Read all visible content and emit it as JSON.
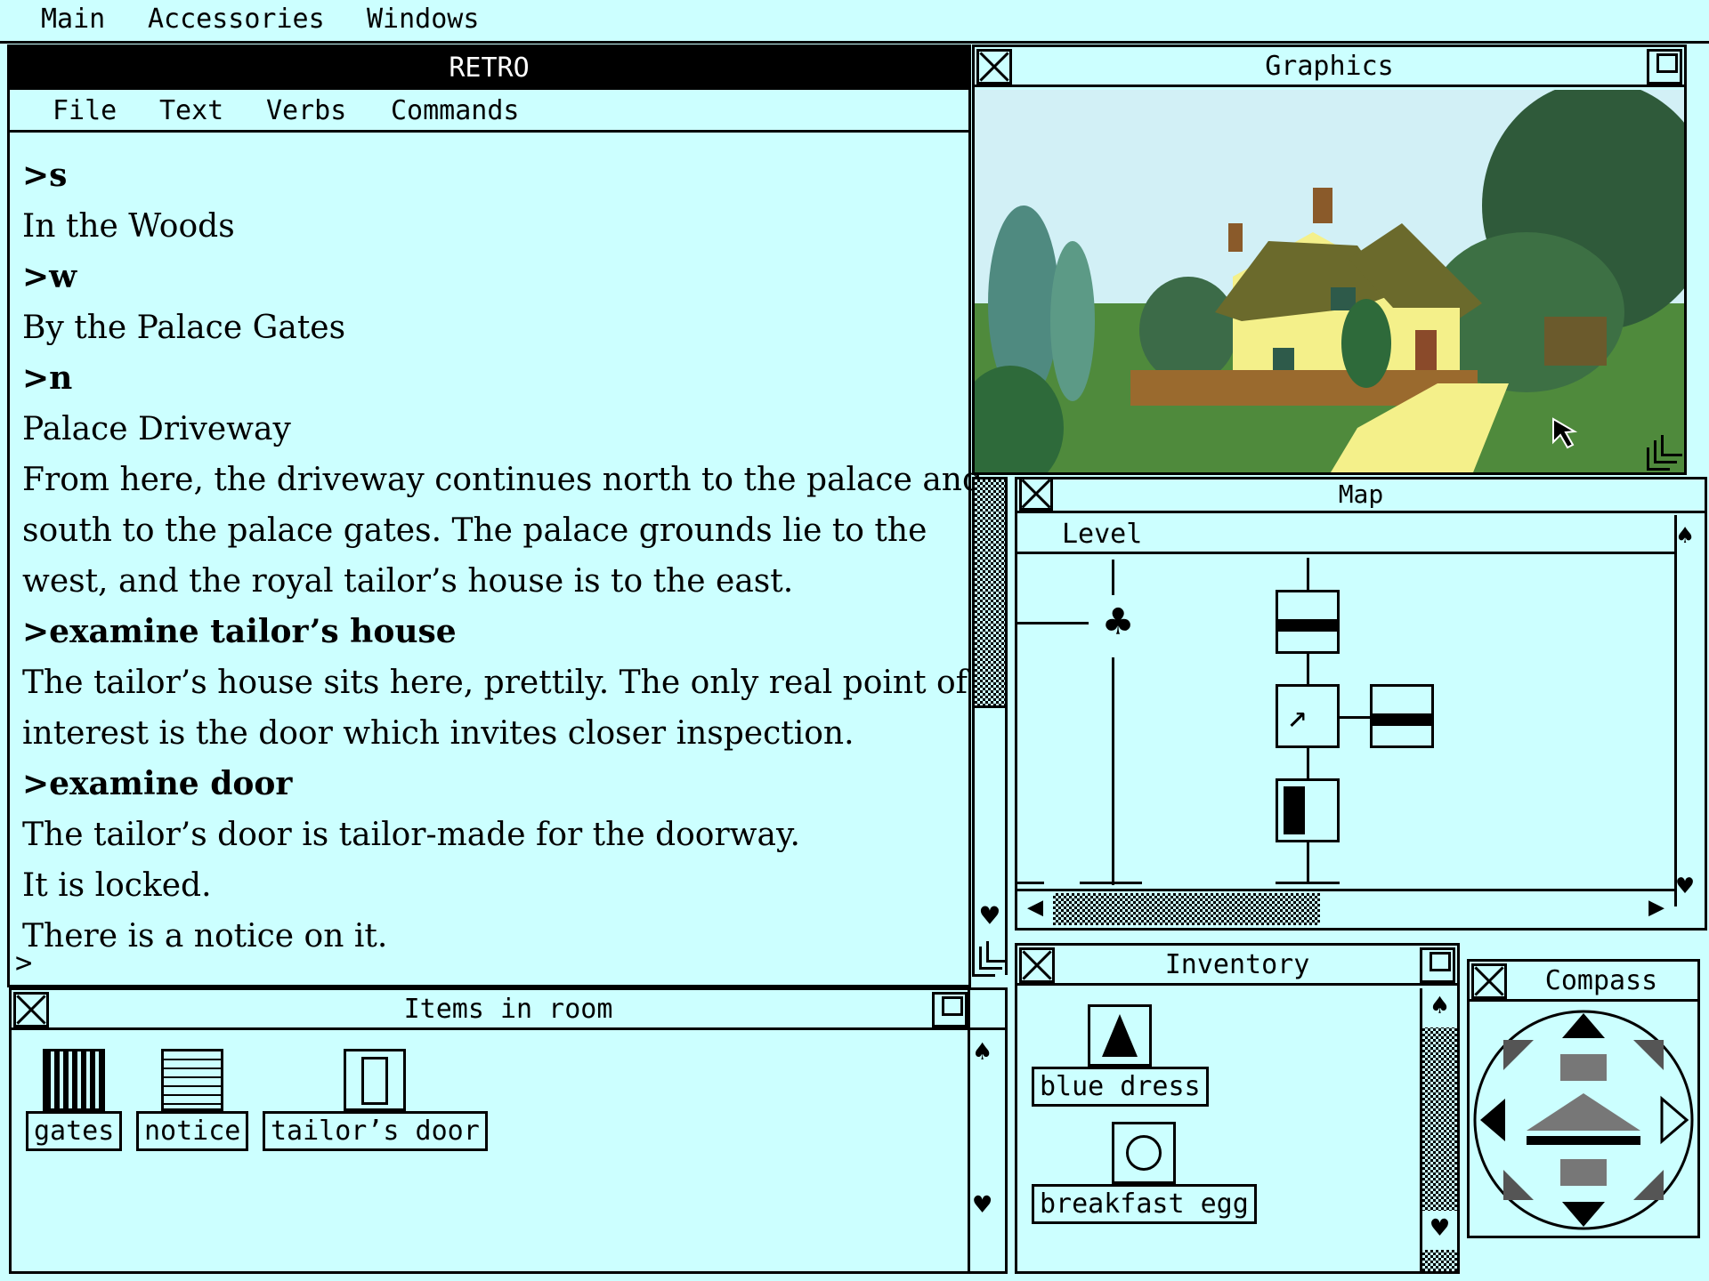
{
  "menubar": {
    "items": [
      "Main",
      "Accessories",
      "Windows"
    ]
  },
  "retro": {
    "title": "RETRO",
    "menu": [
      "File",
      "Text",
      "Verbs",
      "Commands"
    ],
    "log": [
      {
        "text": ">s",
        "cmd": true
      },
      {
        "text": "In the Woods",
        "cmd": false
      },
      {
        "text": ">w",
        "cmd": true
      },
      {
        "text": "By the Palace Gates",
        "cmd": false
      },
      {
        "text": ">n",
        "cmd": true
      },
      {
        "text": "Palace Driveway",
        "cmd": false
      },
      {
        "text": "From here, the driveway continues north to the palace and",
        "cmd": false
      },
      {
        "text": "south to the palace gates. The palace grounds lie to the",
        "cmd": false
      },
      {
        "text": "west, and the royal tailor’s house is to the east.",
        "cmd": false
      },
      {
        "text": ">examine tailor’s house",
        "cmd": true
      },
      {
        "text": "The tailor’s house sits here, prettily. The only real point of",
        "cmd": false
      },
      {
        "text": "interest is the door which invites closer inspection.",
        "cmd": false
      },
      {
        "text": ">examine door",
        "cmd": true
      },
      {
        "text": "The tailor’s door is tailor-made for the doorway.",
        "cmd": false
      },
      {
        "text": "It is locked.",
        "cmd": false
      },
      {
        "text": "There is a notice on it.",
        "cmd": false
      }
    ],
    "prompt": ">"
  },
  "graphics": {
    "title": "Graphics"
  },
  "map": {
    "title": "Map",
    "menu": "Level"
  },
  "items_room": {
    "title": "Items in room",
    "items": [
      {
        "label": "gates",
        "icon": "gates-icon"
      },
      {
        "label": "notice",
        "icon": "notice-icon"
      },
      {
        "label": "tailor’s door",
        "icon": "door-icon"
      }
    ]
  },
  "inventory": {
    "title": "Inventory",
    "items": [
      {
        "label": "blue dress",
        "icon": "dress-icon"
      },
      {
        "label": "breakfast egg",
        "icon": "egg-icon"
      }
    ]
  },
  "compass": {
    "title": "Compass"
  },
  "colors": {
    "background": "#ccffff",
    "ink": "#000000"
  }
}
